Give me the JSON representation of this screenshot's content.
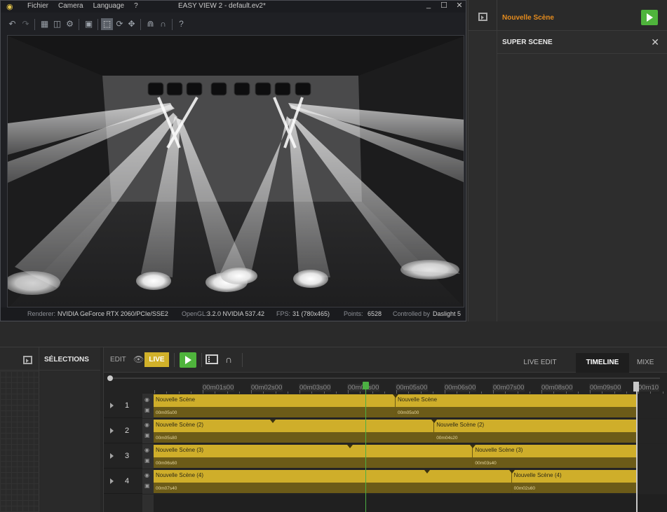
{
  "app": {
    "title": "EASY VIEW 2 - default.ev2*",
    "menu": [
      "Fichier",
      "Camera",
      "Language",
      "?"
    ],
    "window_buttons": [
      "_",
      "☐",
      "✕"
    ]
  },
  "statusbar": {
    "renderer_label": "Renderer:",
    "renderer_value": "NVIDIA GeForce RTX 2060/PCIe/SSE2",
    "opengl_label": "OpenGL:",
    "opengl_value": "3.2.0 NVIDIA 537.42",
    "fps_label": "FPS:",
    "fps_value": "31 (780x465)",
    "points_label": "Points:",
    "points_value": "6528",
    "controlled_label": "Controlled by",
    "controlled_value": "Daslight 5"
  },
  "scene_panel": {
    "scene_name": "Nouvelle Scène",
    "super_scene": "SUPER SCENE",
    "close_icon": "✕"
  },
  "selections": {
    "label": "SÉLECTIONS"
  },
  "timeline": {
    "edit_label": "EDIT",
    "live_label": "LIVE",
    "tabs": [
      "LIVE EDIT",
      "TIMELINE",
      "MIXE"
    ],
    "ruler": [
      "00m01s00",
      "00m02s00",
      "00m03s00",
      "00m04s00",
      "00m05s00",
      "00m06s00",
      "00m07s00",
      "00m08s00",
      "00m09s00",
      "00m10"
    ],
    "tracks": [
      {
        "num": "1",
        "clips": [
          {
            "name": "Nouvelle Scène",
            "dur": "00m05s00"
          },
          {
            "name": "Nouvelle Scène",
            "dur": "00m05s00"
          }
        ]
      },
      {
        "num": "2",
        "clips": [
          {
            "name": "Nouvelle Scène (2)",
            "dur": "00m05s80"
          },
          {
            "name": "Nouvelle Scène (2)",
            "dur": "00m04s20"
          }
        ]
      },
      {
        "num": "3",
        "clips": [
          {
            "name": "Nouvelle Scène (3)",
            "dur": "00m06s60"
          },
          {
            "name": "Nouvelle Scène (3)",
            "dur": "00m03s40"
          }
        ]
      },
      {
        "num": "4",
        "clips": [
          {
            "name": "Nouvelle Scène (4)",
            "dur": "00m07s40"
          },
          {
            "name": "Nouvelle Scène (4)",
            "dur": "00m02s60"
          }
        ]
      }
    ]
  },
  "colors": {
    "accent_orange": "#e58c1e",
    "play_green": "#4fb43c",
    "clip_yellow": "#cfae2a",
    "live_yellow": "#d1b12a"
  }
}
